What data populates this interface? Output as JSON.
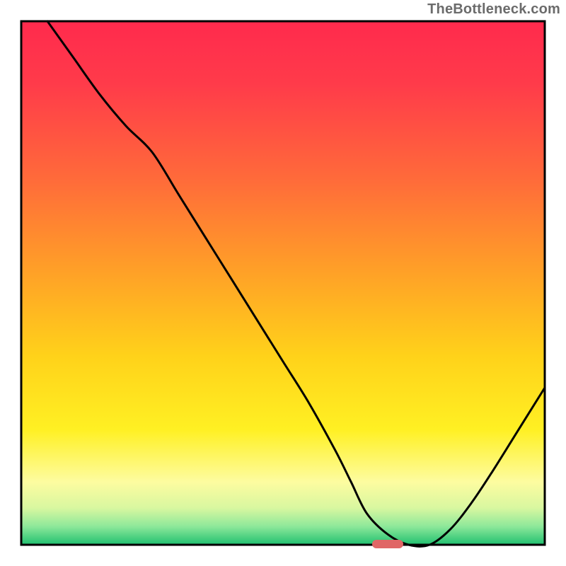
{
  "watermark": "TheBottleneck.com",
  "chart_data": {
    "type": "line",
    "title": "",
    "xlabel": "",
    "ylabel": "",
    "xlim": [
      0,
      100
    ],
    "ylim": [
      0,
      100
    ],
    "grid": false,
    "legend": false,
    "annotations": [],
    "marker": {
      "x": 70,
      "y": 0,
      "color": "#e06666"
    },
    "series": [
      {
        "name": "bottleneck-curve",
        "x": [
          5,
          10,
          15,
          20,
          25,
          30,
          35,
          40,
          45,
          50,
          55,
          60,
          63,
          66,
          70,
          74,
          78,
          82,
          86,
          90,
          95,
          100
        ],
        "values": [
          100,
          93,
          86,
          80,
          75,
          67,
          59,
          51,
          43,
          35,
          27,
          18,
          12,
          6,
          2,
          0,
          0,
          3,
          8,
          14,
          22,
          30
        ]
      }
    ],
    "gradient_stops": [
      {
        "offset": 0.0,
        "color": "#ff2a4d"
      },
      {
        "offset": 0.12,
        "color": "#ff3b4a"
      },
      {
        "offset": 0.3,
        "color": "#ff6a3a"
      },
      {
        "offset": 0.48,
        "color": "#ffa127"
      },
      {
        "offset": 0.64,
        "color": "#ffd21a"
      },
      {
        "offset": 0.78,
        "color": "#fff023"
      },
      {
        "offset": 0.88,
        "color": "#fdfca0"
      },
      {
        "offset": 0.93,
        "color": "#d8f7a0"
      },
      {
        "offset": 0.965,
        "color": "#8de89a"
      },
      {
        "offset": 1.0,
        "color": "#20c070"
      }
    ]
  }
}
